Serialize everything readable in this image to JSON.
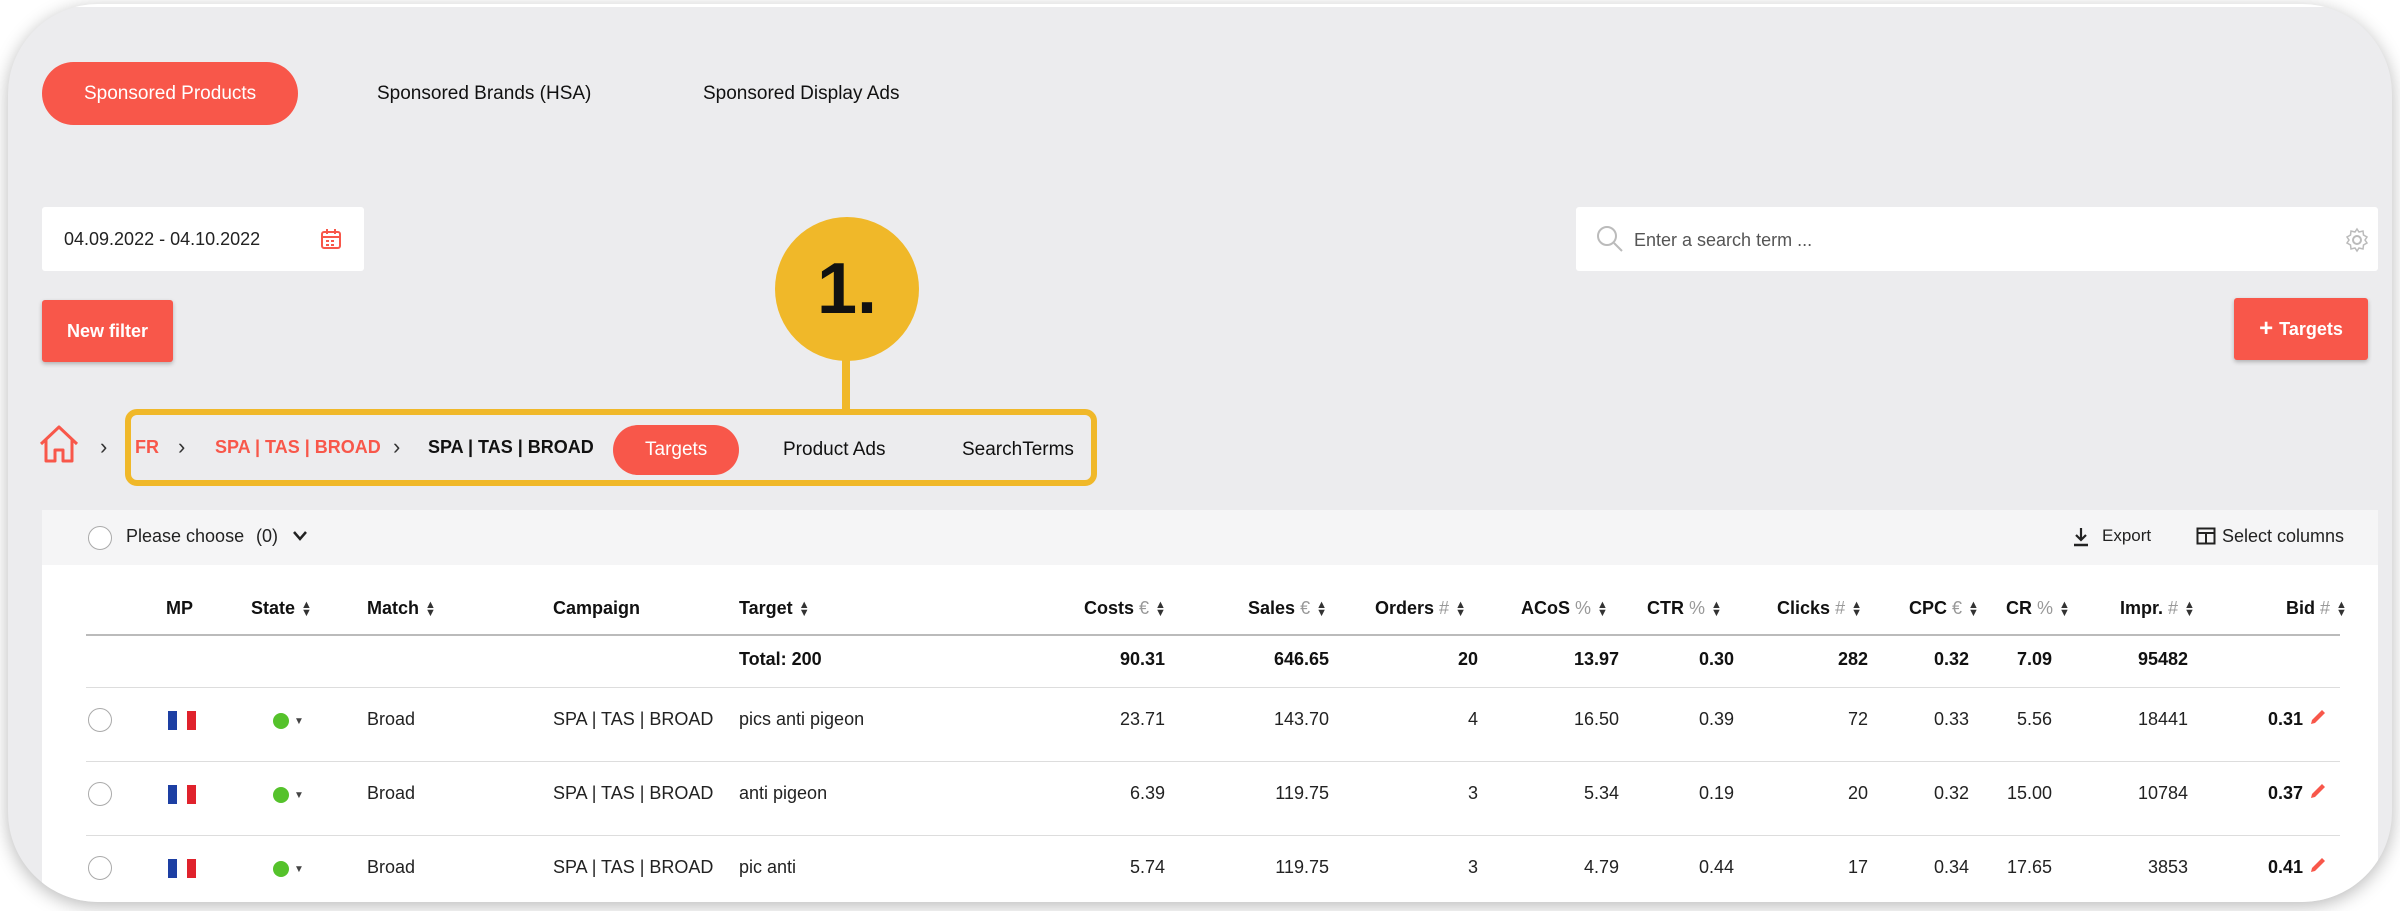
{
  "tabs": [
    {
      "label": "Sponsored Products",
      "active": true
    },
    {
      "label": "Sponsored Brands (HSA)",
      "active": false
    },
    {
      "label": "Sponsored Display Ads",
      "active": false
    }
  ],
  "date_range": "04.09.2022 - 04.10.2022",
  "search": {
    "placeholder": "Enter a search term ..."
  },
  "new_filter_label": "New filter",
  "add_targets_label": "Targets",
  "callout_label": "1.",
  "breadcrumb": {
    "marketplace": "FR",
    "portfolio": "SPA | TAS | BROAD",
    "campaign": "SPA | TAS | BROAD"
  },
  "subtabs": [
    {
      "label": "Targets",
      "active": true
    },
    {
      "label": "Product Ads",
      "active": false
    },
    {
      "label": "SearchTerms",
      "active": false
    }
  ],
  "toolbar": {
    "please_choose": "Please choose",
    "count": "(0)",
    "export": "Export",
    "select_columns": "Select columns"
  },
  "columns": {
    "mp": "MP",
    "state": "State",
    "match": "Match",
    "campaign": "Campaign",
    "target": "Target",
    "costs": "Costs",
    "costs_unit": "€",
    "sales": "Sales",
    "sales_unit": "€",
    "orders": "Orders",
    "orders_unit": "#",
    "acos": "ACoS",
    "acos_unit": "%",
    "ctr": "CTR",
    "ctr_unit": "%",
    "clicks": "Clicks",
    "clicks_unit": "#",
    "cpc": "CPC",
    "cpc_unit": "€",
    "cr": "CR",
    "cr_unit": "%",
    "impr": "Impr.",
    "impr_unit": "#",
    "bid": "Bid",
    "bid_unit": "#"
  },
  "totals": {
    "label": "Total: 200",
    "costs": "90.31",
    "sales": "646.65",
    "orders": "20",
    "acos": "13.97",
    "ctr": "0.30",
    "clicks": "282",
    "cpc": "0.32",
    "cr": "7.09",
    "impr": "95482"
  },
  "rows": [
    {
      "match": "Broad",
      "campaign": "SPA | TAS | BROAD",
      "target": "pics anti pigeon",
      "costs": "23.71",
      "sales": "143.70",
      "orders": "4",
      "acos": "16.50",
      "ctr": "0.39",
      "clicks": "72",
      "cpc": "0.33",
      "cr": "5.56",
      "impr": "18441",
      "bid": "0.31"
    },
    {
      "match": "Broad",
      "campaign": "SPA | TAS | BROAD",
      "target": "anti pigeon",
      "costs": "6.39",
      "sales": "119.75",
      "orders": "3",
      "acos": "5.34",
      "ctr": "0.19",
      "clicks": "20",
      "cpc": "0.32",
      "cr": "15.00",
      "impr": "10784",
      "bid": "0.37"
    },
    {
      "match": "Broad",
      "campaign": "SPA | TAS | BROAD",
      "target": "pic anti",
      "costs": "5.74",
      "sales": "119.75",
      "orders": "3",
      "acos": "4.79",
      "ctr": "0.44",
      "clicks": "17",
      "cpc": "0.34",
      "cr": "17.65",
      "impr": "3853",
      "bid": "0.41"
    }
  ],
  "colors": {
    "accent": "#f8574a",
    "callout": "#f0b829",
    "state_active": "#55c22b"
  }
}
